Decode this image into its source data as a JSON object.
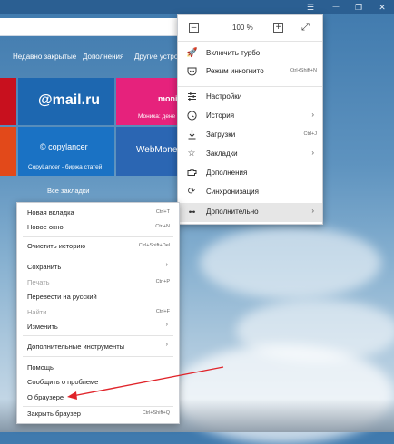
{
  "window": {
    "menu_glyph": "☰",
    "minimize_glyph": "—",
    "restore_glyph": "❐",
    "close_glyph": "✕"
  },
  "bookmarks_bar": {
    "recent": "Недавно закрытые",
    "addons": "Дополнения",
    "other": "Другие устрой"
  },
  "tiles": {
    "mail_logo": "@mail.ru",
    "monika_logo": "moni",
    "monika_caption": "Моника: дене",
    "copylancer_logo": "copylancer",
    "copylancer_caption": "CopyLancer - биржа статей",
    "webmoney_logo": "WebMoney"
  },
  "all_bookmarks": "Все закладки",
  "main_menu": {
    "zoom_minus": "–",
    "zoom_value": "100 %",
    "zoom_plus": "+",
    "fullscreen_glyph": "⤢",
    "items": [
      {
        "label": "Включить турбо",
        "shortcut": "",
        "arrow": ""
      },
      {
        "label": "Режим инкогнито",
        "shortcut": "Ctrl+Shift+N",
        "arrow": ""
      },
      {
        "label": "Настройки",
        "shortcut": "",
        "arrow": ""
      },
      {
        "label": "История",
        "shortcut": "",
        "arrow": "›"
      },
      {
        "label": "Загрузки",
        "shortcut": "Ctrl+J",
        "arrow": ""
      },
      {
        "label": "Закладки",
        "shortcut": "",
        "arrow": "›"
      },
      {
        "label": "Дополнения",
        "shortcut": "",
        "arrow": ""
      },
      {
        "label": "Синхронизация",
        "shortcut": "",
        "arrow": ""
      },
      {
        "label": "Дополнительно",
        "shortcut": "",
        "arrow": "›"
      }
    ]
  },
  "sub_menu": {
    "items": [
      {
        "label": "Новая вкладка",
        "shortcut": "Ctrl+T"
      },
      {
        "label": "Новое окно",
        "shortcut": "Ctrl+N"
      },
      {
        "label": "Очистить историю",
        "shortcut": "Ctrl+Shift+Del"
      },
      {
        "label": "Сохранить",
        "arrow": "›"
      },
      {
        "label": "Печать",
        "shortcut": "Ctrl+P"
      },
      {
        "label": "Перевести на русский"
      },
      {
        "label": "Найти",
        "shortcut": "Ctrl+F"
      },
      {
        "label": "Изменить",
        "arrow": "›"
      },
      {
        "label": "Дополнительные инструменты",
        "arrow": "›"
      },
      {
        "label": "Помощь"
      },
      {
        "label": "Сообщить о проблеме"
      },
      {
        "label": "О браузере"
      },
      {
        "label": "Закрыть браузер",
        "shortcut": "Ctrl+Shift+Q"
      }
    ]
  },
  "colors": {
    "annotation_arrow": "#e0242a",
    "mail_tile": "#1d67b0",
    "monika_tile": "#e6227c",
    "copylancer_tile": "#1a72c4",
    "webmoney_tile": "#2b66b3",
    "red_tile": "#c8101e",
    "orange_tile": "#e2491a"
  }
}
